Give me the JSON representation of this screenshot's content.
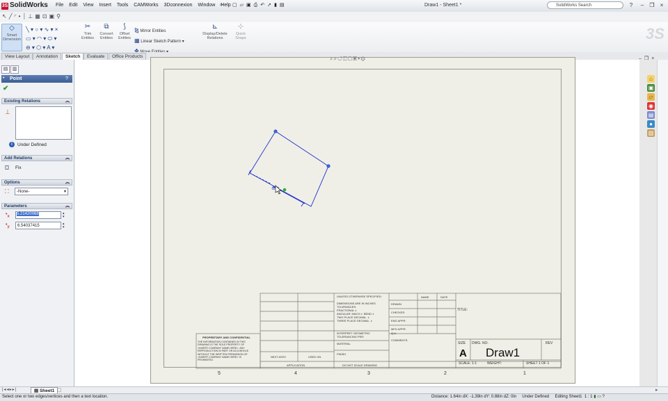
{
  "app": {
    "logo_text": "SolidWorks",
    "doc_title": "Draw1 - Sheet1 *"
  },
  "menu": [
    "File",
    "Edit",
    "View",
    "Insert",
    "Tools",
    "CAMWorks",
    "3Dconnexion",
    "Window",
    "Help"
  ],
  "search": {
    "placeholder": "SolidWorks Search"
  },
  "command_manager": {
    "smart_dimension": "Smart Dimension",
    "trim_entities": "Trim Entities",
    "convert_entities": "Convert Entities",
    "offset_entities": "Offset Entities",
    "mirror_entities": "Mirror Entities",
    "linear_sketch_pattern": "Linear Sketch Pattern",
    "move_entities": "Move Entities",
    "display_delete_relations": "Display/Delete Relations",
    "quick_snaps": "Quick Snaps"
  },
  "tabs": [
    {
      "label": "View Layout"
    },
    {
      "label": "Annotation"
    },
    {
      "label": "Sketch"
    },
    {
      "label": "Evaluate"
    },
    {
      "label": "Office Products"
    }
  ],
  "property_manager": {
    "title": "Point",
    "help": "?",
    "existing_relations": {
      "header": "Existing Relations",
      "status": "Under Defined"
    },
    "add_relations": {
      "header": "Add Relations",
      "fix_label": "Fix"
    },
    "options": {
      "header": "Options",
      "selected": "-None-"
    },
    "parameters": {
      "header": "Parameters",
      "x_label": "x",
      "y_label": "y",
      "x_value": "5.21420068",
      "y_value": "6.54037415"
    }
  },
  "sheet": {
    "zones": [
      "5",
      "4",
      "3",
      "2",
      "1"
    ],
    "title_block": {
      "unless_note": "UNLESS OTHERWISE SPECIFIED:",
      "dims_note": "DIMENSIONS ARE IN INCHES\nTOLERANCES:\nFRACTIONAL ±\nANGULAR: MACH ±  BEND ±\nTWO PLACE DECIMAL  ±\nTHREE PLACE DECIMAL  ±",
      "name": "NAME",
      "date": "DATE",
      "drawn": "DRAWN",
      "checked": "CHECKED",
      "eng_appr": "ENG APPR.",
      "mfg_appr": "MFG APPR.",
      "qa": "Q.A.",
      "comments": "COMMENTS:",
      "interpret": "INTERPRET GEOMETRIC\nTOLERANCING PER:",
      "material": "MATERIAL",
      "finish": "FINISH",
      "next_assy": "NEXT ASSY",
      "used_on": "USED ON",
      "application": "APPLICATION",
      "do_not_scale": "DO NOT SCALE DRAWING",
      "proprietary_head": "PROPRIETARY AND CONFIDENTIAL",
      "proprietary_body": "THE INFORMATION CONTAINED IN THIS\nDRAWING IS THE SOLE PROPERTY OF\n<INSERT COMPANY NAME HERE>. ANY\nREPRODUCTION IN PART OR AS A WHOLE\nWITHOUT THE WRITTEN PERMISSION OF\n<INSERT COMPANY NAME HERE> IS\nPROHIBITED.",
      "title_label": "TITLE:",
      "size_label": "SIZE",
      "dwg_no_label": "DWG.  NO.",
      "rev_label": "REV",
      "size_value": "A",
      "dwg_no_value": "Draw1",
      "scale": "SCALE: 1:1",
      "weight": "WEIGHT:",
      "sheet": "SHEET 1 OF 1"
    }
  },
  "sheet_tab": "Sheet1",
  "status": {
    "left": "Select one or two edges/vertices and then a text location.",
    "distance": "Distance: 1.64in  dX: -1.39in  dY: 0.88in  dZ: 0in",
    "defined": "Under Defined",
    "editing": "Editing Sheet1",
    "scale": "1 : 1"
  },
  "colors": {
    "sketch": "#1a2ccc",
    "sheet": "#efefe7",
    "header_blue": "#3a5d95",
    "selection": "#3d6fd0"
  }
}
